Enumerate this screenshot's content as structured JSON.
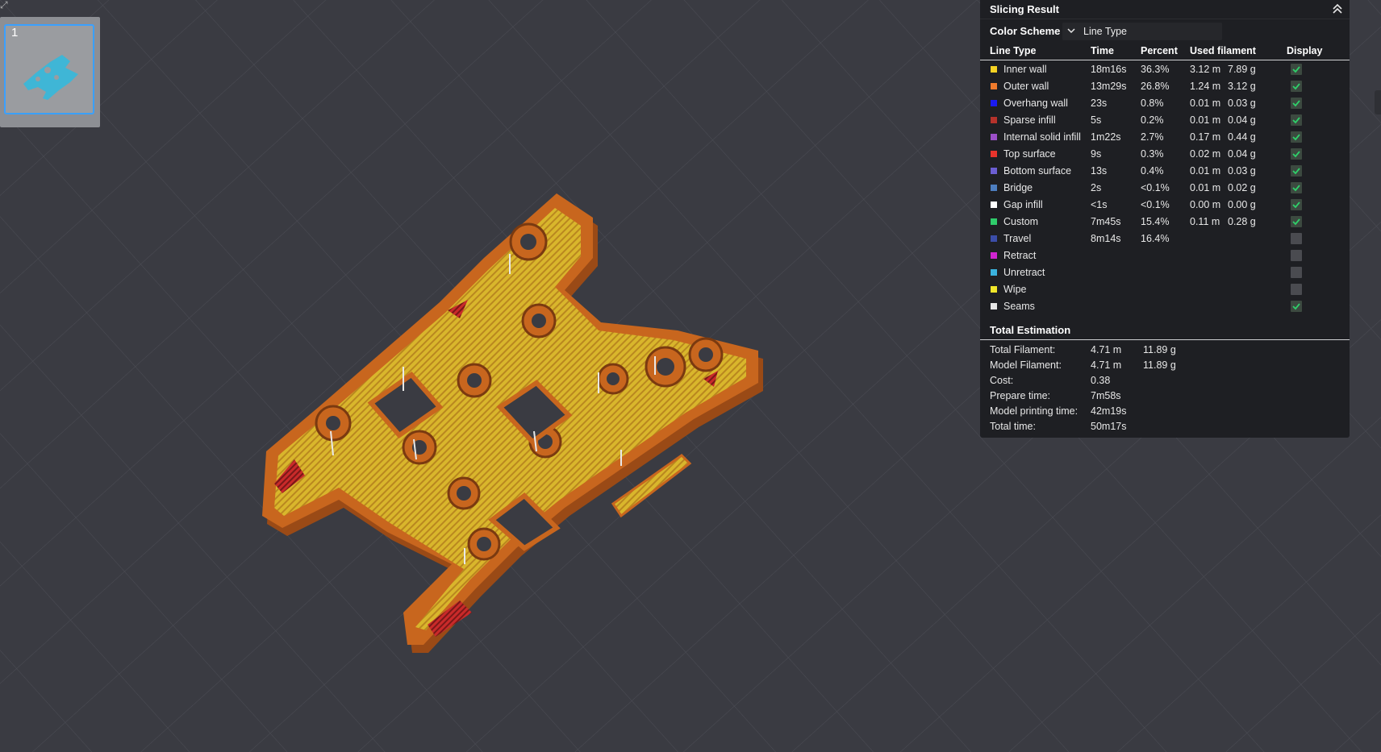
{
  "plate": {
    "number": "1"
  },
  "panel": {
    "title": "Slicing Result",
    "color_scheme_label": "Color Scheme",
    "color_scheme_value": "Line Type",
    "columns": [
      "Line Type",
      "Time",
      "Percent",
      "Used filament",
      "Display"
    ],
    "rows": [
      {
        "name": "Inner wall",
        "color": "#f5d223",
        "time": "18m16s",
        "percent": "36.3%",
        "length": "3.12 m",
        "weight": "7.89 g",
        "display": true
      },
      {
        "name": "Outer wall",
        "color": "#f07b2c",
        "time": "13m29s",
        "percent": "26.8%",
        "length": "1.24 m",
        "weight": "3.12 g",
        "display": true
      },
      {
        "name": "Overhang wall",
        "color": "#1a1af0",
        "time": "23s",
        "percent": "0.8%",
        "length": "0.01 m",
        "weight": "0.03 g",
        "display": true
      },
      {
        "name": "Sparse infill",
        "color": "#b5322b",
        "time": "5s",
        "percent": "0.2%",
        "length": "0.01 m",
        "weight": "0.04 g",
        "display": true
      },
      {
        "name": "Internal solid infill",
        "color": "#9b4fc8",
        "time": "1m22s",
        "percent": "2.7%",
        "length": "0.17 m",
        "weight": "0.44 g",
        "display": true
      },
      {
        "name": "Top surface",
        "color": "#e8342c",
        "time": "9s",
        "percent": "0.3%",
        "length": "0.02 m",
        "weight": "0.04 g",
        "display": true
      },
      {
        "name": "Bottom surface",
        "color": "#6b5ed2",
        "time": "13s",
        "percent": "0.4%",
        "length": "0.01 m",
        "weight": "0.03 g",
        "display": true
      },
      {
        "name": "Bridge",
        "color": "#4d7ec0",
        "time": "2s",
        "percent": "<0.1%",
        "length": "0.01 m",
        "weight": "0.02 g",
        "display": true
      },
      {
        "name": "Gap infill",
        "color": "#ffffff",
        "time": "<1s",
        "percent": "<0.1%",
        "length": "0.00 m",
        "weight": "0.00 g",
        "display": true
      },
      {
        "name": "Custom",
        "color": "#2fcc6b",
        "time": "7m45s",
        "percent": "15.4%",
        "length": "0.11 m",
        "weight": "0.28 g",
        "display": true
      },
      {
        "name": "Travel",
        "color": "#3b4da8",
        "time": "8m14s",
        "percent": "16.4%",
        "length": "",
        "weight": "",
        "display": false
      },
      {
        "name": "Retract",
        "color": "#d024d0",
        "time": "",
        "percent": "",
        "length": "",
        "weight": "",
        "display": false
      },
      {
        "name": "Unretract",
        "color": "#3ab2de",
        "time": "",
        "percent": "",
        "length": "",
        "weight": "",
        "display": false
      },
      {
        "name": "Wipe",
        "color": "#f0e62a",
        "time": "",
        "percent": "",
        "length": "",
        "weight": "",
        "display": false
      },
      {
        "name": "Seams",
        "color": "#e6e6e6",
        "time": "",
        "percent": "",
        "length": "",
        "weight": "",
        "display": true
      }
    ],
    "total_title": "Total Estimation",
    "estimation": [
      {
        "label": "Total Filament:",
        "v1": "4.71 m",
        "v2": "11.89 g"
      },
      {
        "label": "Model Filament:",
        "v1": "4.71 m",
        "v2": "11.89 g"
      },
      {
        "label": "Cost:",
        "v1": "0.38",
        "v2": ""
      },
      {
        "label": "Prepare time:",
        "v1": "7m58s",
        "v2": ""
      },
      {
        "label": "Model printing time:",
        "v1": "42m19s",
        "v2": ""
      },
      {
        "label": "Total time:",
        "v1": "50m17s",
        "v2": ""
      }
    ]
  },
  "colors": {
    "background": "#3a3b42",
    "part_orange": "#c8661e",
    "part_yellow": "#d8c030",
    "selection_blue": "#3aa0ff"
  }
}
